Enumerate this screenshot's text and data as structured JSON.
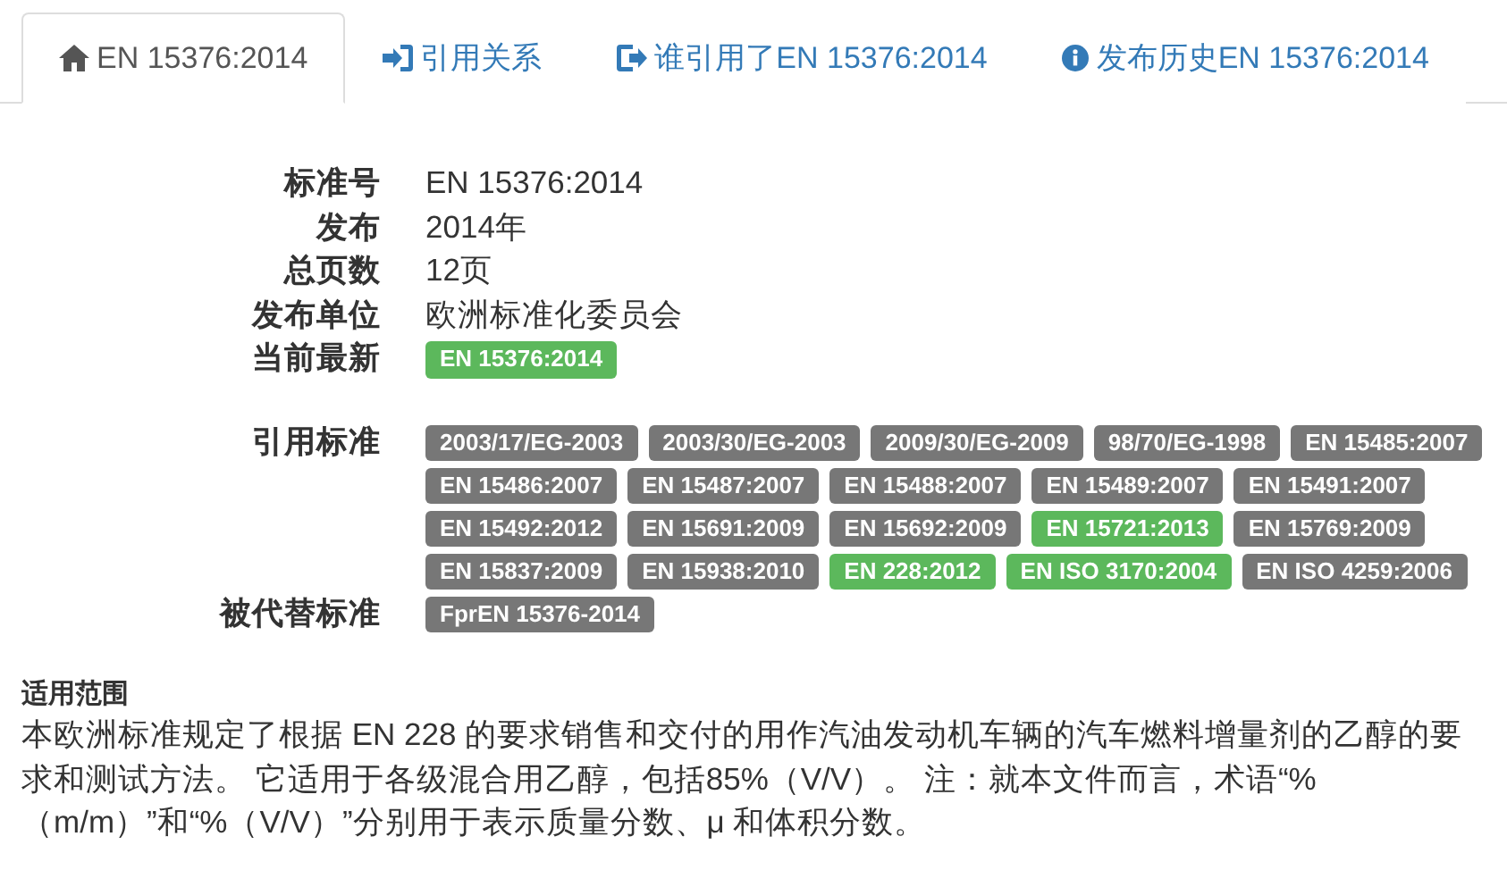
{
  "tabs": [
    {
      "label": "EN 15376:2014",
      "selected": true
    },
    {
      "label": "引用关系",
      "selected": false
    },
    {
      "label": "谁引用了EN 15376:2014",
      "selected": false
    },
    {
      "label": "发布历史EN 15376:2014",
      "selected": false
    }
  ],
  "details": [
    {
      "label": "标准号",
      "value": "EN 15376:2014"
    },
    {
      "label": "发布",
      "value": "2014年"
    },
    {
      "label": "总页数",
      "value": "12页"
    },
    {
      "label": "发布单位",
      "value": "欧洲标准化委员会"
    }
  ],
  "latest": {
    "label": "当前最新",
    "badges": [
      {
        "text": "EN 15376:2014",
        "color": "#5cb85c"
      }
    ]
  },
  "references": {
    "label": "引用标准",
    "badges": [
      {
        "text": "2003/17/EG-2003",
        "color": "#777777"
      },
      {
        "text": "2003/30/EG-2003",
        "color": "#777777"
      },
      {
        "text": "2009/30/EG-2009",
        "color": "#777777"
      },
      {
        "text": "98/70/EG-1998",
        "color": "#777777"
      },
      {
        "text": "EN 15485:2007",
        "color": "#777777"
      },
      {
        "text": "EN 15486:2007",
        "color": "#777777"
      },
      {
        "text": "EN 15487:2007",
        "color": "#777777"
      },
      {
        "text": "EN 15488:2007",
        "color": "#777777"
      },
      {
        "text": "EN 15489:2007",
        "color": "#777777"
      },
      {
        "text": "EN 15491:2007",
        "color": "#777777"
      },
      {
        "text": "EN 15492:2012",
        "color": "#777777"
      },
      {
        "text": "EN 15691:2009",
        "color": "#777777"
      },
      {
        "text": "EN 15692:2009",
        "color": "#777777"
      },
      {
        "text": "EN 15721:2013",
        "color": "#5cb85c"
      },
      {
        "text": "EN 15769:2009",
        "color": "#777777"
      },
      {
        "text": "EN 15837:2009",
        "color": "#777777"
      },
      {
        "text": "EN 15938:2010",
        "color": "#777777"
      },
      {
        "text": "EN 228:2012",
        "color": "#5cb85c"
      },
      {
        "text": "EN ISO 3170:2004",
        "color": "#5cb85c"
      },
      {
        "text": "EN ISO 4259:2006",
        "color": "#777777"
      }
    ]
  },
  "replaces": {
    "label": "被代替标准",
    "badges": [
      {
        "text": "FprEN 15376-2014",
        "color": "#777777"
      }
    ]
  },
  "scope": {
    "title": "适用范围",
    "text": "本欧洲标准规定了根据 EN 228 的要求销售和交付的用作汽油发动机车辆的汽车燃料增量剂的乙醇的要求和测试方法。 它适用于各级混合用乙醇，包括85%（V/V）。 注：就本文件而言，术语“%（m/m）”和“%（V/V）”分别用于表示质量分数、μ 和体积分数。"
  }
}
